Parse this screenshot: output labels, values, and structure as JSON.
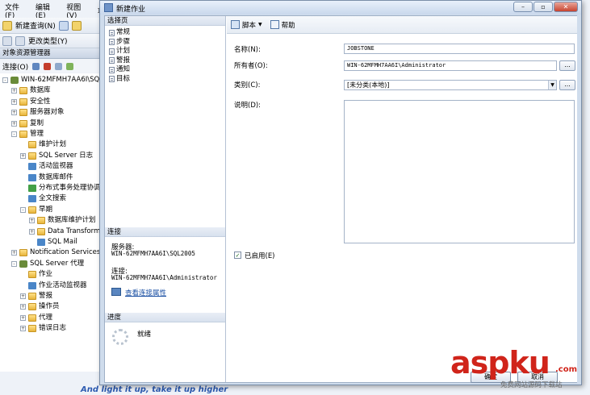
{
  "ssms": {
    "menu": [
      "文件(F)",
      "编辑(E)",
      "视图(V)",
      "项"
    ],
    "toolbar": {
      "new_query": "新建查询(N)",
      "change_type": "更改类型(Y)"
    },
    "object_explorer": {
      "title": "对象资源管理器",
      "connect": "连接(O)",
      "tree": [
        {
          "label": "WIN-62MFMH7AA6I\\SQL2005",
          "level": 0,
          "expander": "-",
          "icon": "server"
        },
        {
          "label": "数据库",
          "level": 1,
          "expander": "+",
          "icon": "folder"
        },
        {
          "label": "安全性",
          "level": 1,
          "expander": "+",
          "icon": "folder"
        },
        {
          "label": "服务器对象",
          "level": 1,
          "expander": "+",
          "icon": "folder"
        },
        {
          "label": "复制",
          "level": 1,
          "expander": "+",
          "icon": "folder"
        },
        {
          "label": "管理",
          "level": 1,
          "expander": "-",
          "icon": "folder"
        },
        {
          "label": "维护计划",
          "level": 2,
          "expander": "",
          "icon": "folder"
        },
        {
          "label": "SQL Server 日志",
          "level": 2,
          "expander": "+",
          "icon": "folder"
        },
        {
          "label": "活动监视器",
          "level": 2,
          "expander": "",
          "icon": "blue"
        },
        {
          "label": "数据库邮件",
          "level": 2,
          "expander": "",
          "icon": "blue"
        },
        {
          "label": "分布式事务处理协调器",
          "level": 2,
          "expander": "",
          "icon": "green"
        },
        {
          "label": "全文搜索",
          "level": 2,
          "expander": "",
          "icon": "blue"
        },
        {
          "label": "早期",
          "level": 2,
          "expander": "-",
          "icon": "folder"
        },
        {
          "label": "数据库维护计划",
          "level": 3,
          "expander": "+",
          "icon": "folder"
        },
        {
          "label": "Data Transformation",
          "level": 3,
          "expander": "+",
          "icon": "folder"
        },
        {
          "label": "SQL Mail",
          "level": 3,
          "expander": "",
          "icon": "blue"
        },
        {
          "label": "Notification Services",
          "level": 1,
          "expander": "+",
          "icon": "folder"
        },
        {
          "label": "SQL Server 代理",
          "level": 1,
          "expander": "-",
          "icon": "server"
        },
        {
          "label": "作业",
          "level": 2,
          "expander": "",
          "icon": "folder"
        },
        {
          "label": "作业活动监视器",
          "level": 2,
          "expander": "",
          "icon": "blue"
        },
        {
          "label": "警报",
          "level": 2,
          "expander": "+",
          "icon": "folder"
        },
        {
          "label": "操作员",
          "level": 2,
          "expander": "+",
          "icon": "folder"
        },
        {
          "label": "代理",
          "level": 2,
          "expander": "+",
          "icon": "folder"
        },
        {
          "label": "错误日志",
          "level": 2,
          "expander": "+",
          "icon": "folder"
        }
      ]
    },
    "bottom_text": "And light it up, take it up higher"
  },
  "dialog": {
    "title": "新建作业",
    "select_page_header": "选择页",
    "pages": [
      "常规",
      "步骤",
      "计划",
      "警报",
      "通知",
      "目标"
    ],
    "connection_header": "连接",
    "server_label": "服务器:",
    "server_value": "WIN-62MFMH7AA6I\\SQL2005",
    "connection_label": "连接:",
    "connection_value": "WIN-62MFMH7AA6I\\Administrator",
    "view_connection_link": "查看连接属性",
    "progress_header": "进度",
    "progress_status": "就绪",
    "toolbar": {
      "script": "脚本",
      "help": "帮助"
    },
    "form": {
      "name_label": "名称(N):",
      "name_value": "JOBSTONE",
      "owner_label": "所有者(O):",
      "owner_value": "WIN-62MFMH7AA6I\\Administrator",
      "category_label": "类别(C):",
      "category_value": "[未分类(本地)]",
      "description_label": "说明(D):",
      "enabled_label": "已启用(E)",
      "enabled": true,
      "ellipsis": "..."
    },
    "buttons": {
      "ok": "确定",
      "cancel": "取消"
    }
  },
  "watermark": {
    "logo": "asp",
    "logo2": "ku",
    "domain": ".com",
    "sub": "免费网站源码下载站"
  }
}
